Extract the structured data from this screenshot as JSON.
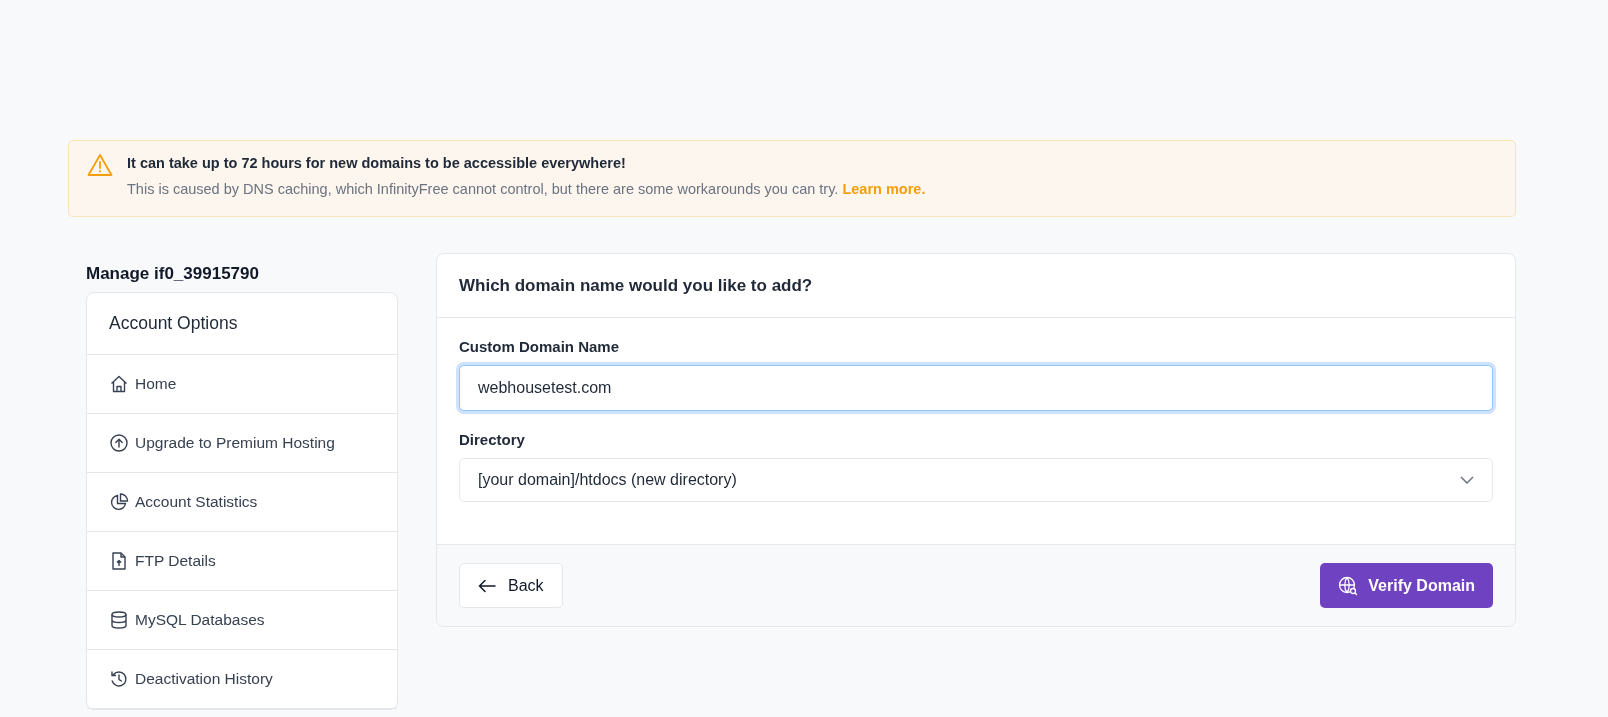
{
  "alert": {
    "title": "It can take up to 72 hours for new domains to be accessible everywhere!",
    "text": "This is caused by DNS caching, which InfinityFree cannot control, but there are some workarounds you can try.",
    "link": "Learn more."
  },
  "sidebar": {
    "heading": "Manage if0_39915790",
    "title": "Account Options",
    "items": [
      {
        "label": "Home",
        "kind": "home"
      },
      {
        "label": "Upgrade to Premium Hosting",
        "kind": "upgrade"
      },
      {
        "label": "Account Statistics",
        "kind": "stats"
      },
      {
        "label": "FTP Details",
        "kind": "file"
      },
      {
        "label": "MySQL Databases",
        "kind": "database"
      },
      {
        "label": "Deactivation History",
        "kind": "history"
      }
    ]
  },
  "form": {
    "title": "Which domain name would you like to add?",
    "domain_label": "Custom Domain Name",
    "domain_value": "webhousetest.com",
    "directory_label": "Directory",
    "directory_value": "[your domain]/htdocs (new directory)",
    "back": "Back",
    "submit": "Verify Domain"
  }
}
